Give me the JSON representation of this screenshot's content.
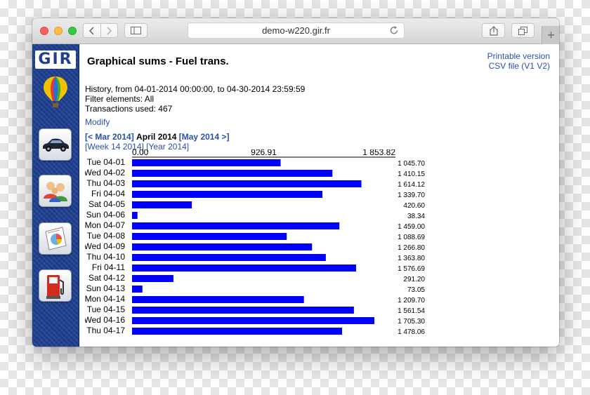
{
  "browser": {
    "url": "demo-w220.gir.fr",
    "new_tab_label": "+"
  },
  "sidebar": {
    "logo_text": "GIR",
    "items": [
      {
        "icon": "car-icon"
      },
      {
        "icon": "users-icon"
      },
      {
        "icon": "report-icon"
      },
      {
        "icon": "fuel-pump-icon"
      }
    ]
  },
  "page": {
    "title": "Graphical sums - Fuel trans.",
    "printable_label": "Printable version",
    "csv_label": "CSV file (",
    "csv_v1": "V1",
    "csv_v2": "V2",
    "csv_close": ")",
    "history_line": "History, from 04-01-2014 00:00:00, to 04-30-2014 23:59:59",
    "filter_line": "Filter elements: All",
    "transactions_line": "Transactions used: 467",
    "modify_label": "Modify",
    "prev_month": "[< Mar 2014]",
    "current_month": "April 2014",
    "next_month": "[May 2014 >]",
    "week_link": "[Week 14 2014]",
    "year_link": "[Year 2014]"
  },
  "colors": {
    "bar": "#0000ff",
    "link": "#2a51b0",
    "sidebar": "#1e3f90"
  },
  "chart_data": {
    "type": "bar",
    "orientation": "horizontal",
    "axis_ticks": [
      "0.00",
      "926.91",
      "1 853.82"
    ],
    "xlim": [
      0,
      1853.82
    ],
    "categories": [
      "Tue 04-01",
      "Wed 04-02",
      "Thu 04-03",
      "Fri 04-04",
      "Sat 04-05",
      "Sun 04-06",
      "Mon 04-07",
      "Tue 04-08",
      "Wed 04-09",
      "Thu 04-10",
      "Fri 04-11",
      "Sat 04-12",
      "Sun 04-13",
      "Mon 04-14",
      "Tue 04-15",
      "Wed 04-16",
      "Thu 04-17"
    ],
    "values": [
      1045.7,
      1410.15,
      1614.12,
      1339.7,
      420.6,
      38.34,
      1459.0,
      1088.69,
      1266.8,
      1363.8,
      1576.69,
      291.2,
      73.05,
      1209.7,
      1561.54,
      1705.3,
      1478.06
    ],
    "value_labels": [
      "1 045.70",
      "1 410.15",
      "1 614.12",
      "1 339.70",
      "420.60",
      "38.34",
      "1 459.00",
      "1 088.69",
      "1 266.80",
      "1 363.80",
      "1 576.69",
      "291.20",
      "73.05",
      "1 209.70",
      "1 561.54",
      "1 705.30",
      "1 478.06"
    ]
  }
}
